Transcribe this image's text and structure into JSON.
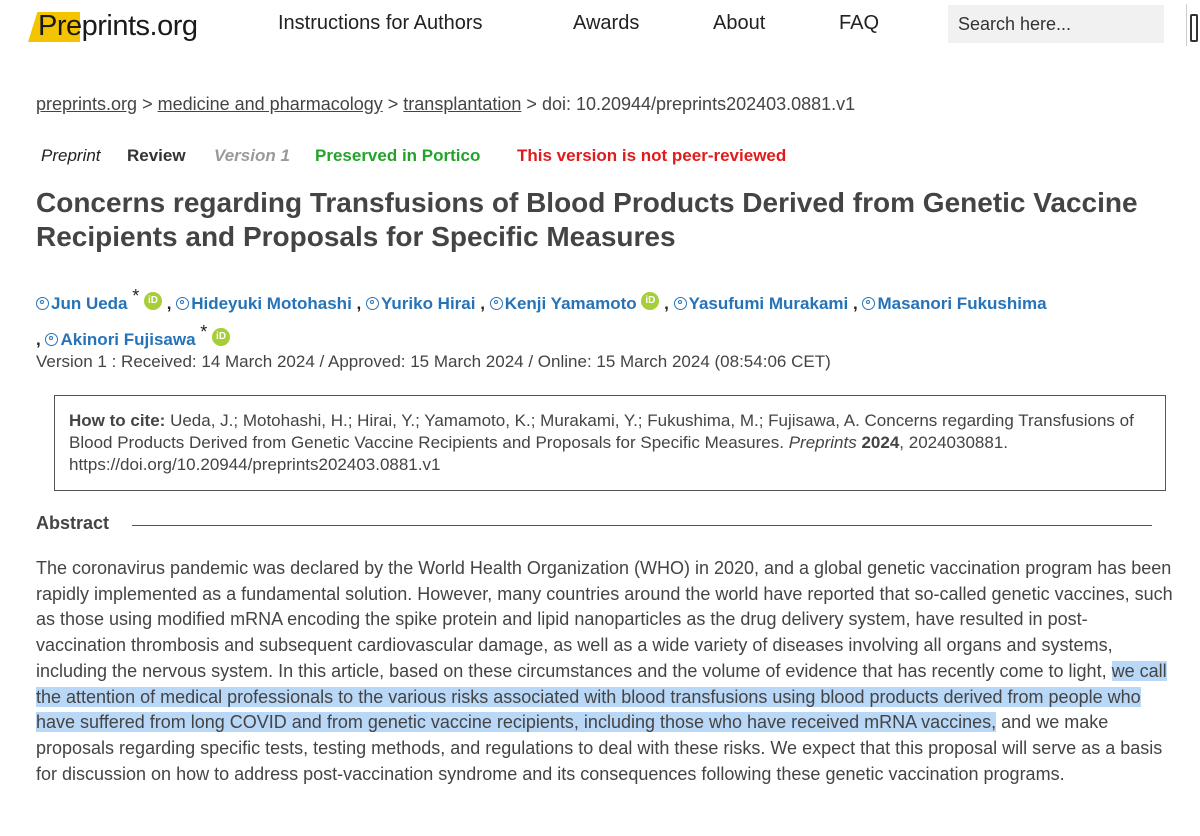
{
  "header": {
    "logo_pre": "Pre",
    "logo_rest": "prints.org",
    "nav": [
      "Instructions for Authors",
      "Awards",
      "About",
      "FAQ"
    ],
    "search_placeholder": "Search here..."
  },
  "breadcrumb": {
    "items": [
      "preprints.org",
      "medicine and pharmacology",
      "transplantation"
    ],
    "separator": ">",
    "doi": "doi: 10.20944/preprints202403.0881.v1"
  },
  "tags": {
    "preprint": "Preprint",
    "review": "Review",
    "version": "Version 1",
    "portico": "Preserved in Portico",
    "peer": "This version is not peer-reviewed"
  },
  "title": "Concerns regarding Transfusions of Blood Products Derived from Genetic Vaccine Recipients and Proposals for Specific Measures",
  "authors": [
    "Jun Ueda",
    "Hideyuki Motohashi",
    "Yuriko Hirai",
    "Kenji Yamamoto",
    "Yasufumi Murakami",
    "Masanori Fukushima",
    "Akinori Fujisawa"
  ],
  "author_star": "*",
  "author_sep": ",",
  "orcid_label": "iD",
  "dates": "Version 1 : Received: 14 March 2024 / Approved: 15 March 2024 / Online: 15 March 2024 (08:54:06 CET)",
  "cite": {
    "label": "How to cite:",
    "text1": "Ueda, J.; Motohashi, H.; Hirai, Y.; Yamamoto, K.; Murakami, Y.; Fukushima, M.; Fujisawa, A. Concerns regarding Transfusions of Blood Products Derived from Genetic Vaccine Recipients and Proposals for Specific Measures.",
    "journal": "Preprints",
    "year": "2024",
    "text2": ", 2024030881. https://doi.org/10.20944/preprints202403.0881.v1"
  },
  "abstract": {
    "heading": "Abstract",
    "before": "The coronavirus pandemic was declared by the World Health Organization (WHO) in 2020, and a global genetic vaccination program has been rapidly implemented as a fundamental solution. However, many countries around the world have reported that so-called genetic vaccines, such as those using modified mRNA encoding the spike protein and lipid nanoparticles as the drug delivery system, have resulted in post-vaccination thrombosis and subsequent cardiovascular damage, as well as a wide variety of diseases involving all organs and systems, including the nervous system. In this article, based on these circumstances and the volume of evidence that has recently come to light, ",
    "highlight": "we call the attention of medical professionals to the various risks associated with blood transfusions using blood products derived from people who have suffered from long COVID and from genetic vaccine recipients, including those who have received mRNA vaccines,",
    "after": " and we make proposals regarding specific tests, testing methods, and regulations to deal with these risks. We expect that this proposal will serve as a basis for discussion on how to address post-vaccination syndrome and its consequences following these genetic vaccination programs."
  }
}
